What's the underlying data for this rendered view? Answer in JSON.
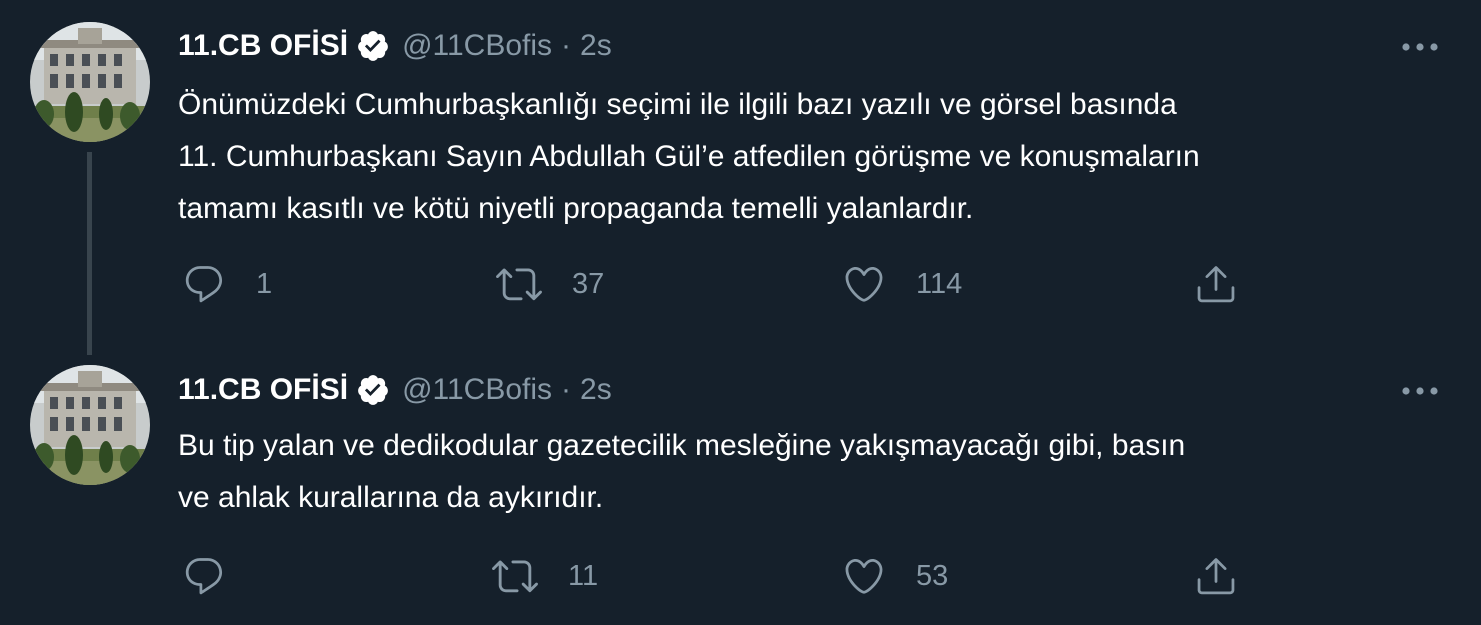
{
  "tweets": [
    {
      "author": {
        "name": "11.CB OFİSİ",
        "handle": "@11CBofis",
        "verified": true,
        "avatar_icon": "palace-photo"
      },
      "separator": "·",
      "time": "2s",
      "text_lines": [
        "Önümüzdeki Cumhurbaşkanlığı seçimi ile ilgili bazı yazılı ve görsel basında",
        "11. Cumhurbaşkanı Sayın Abdullah Gül’e atfedilen görüşme ve konuşmaların",
        "tamamı kasıtlı ve kötü niyetli propaganda temelli yalanlardır."
      ],
      "counts": {
        "reply": "1",
        "retweet": "37",
        "like": "114"
      }
    },
    {
      "author": {
        "name": "11.CB OFİSİ",
        "handle": "@11CBofis",
        "verified": true,
        "avatar_icon": "palace-photo"
      },
      "separator": "·",
      "time": "2s",
      "text_lines": [
        "Bu tip yalan ve dedikodular gazetecilik mesleğine yakışmayacağı gibi, basın",
        "ve ahlak kurallarına da aykırıdır."
      ],
      "counts": {
        "reply": "",
        "retweet": "11",
        "like": "53"
      }
    }
  ],
  "colors": {
    "background": "#15202b",
    "text_primary": "#ffffff",
    "text_secondary": "#8899a6",
    "thread_line": "#38444d"
  },
  "icons": [
    "reply-icon",
    "retweet-icon",
    "like-icon",
    "share-icon",
    "more-icon",
    "verified-badge-icon"
  ]
}
